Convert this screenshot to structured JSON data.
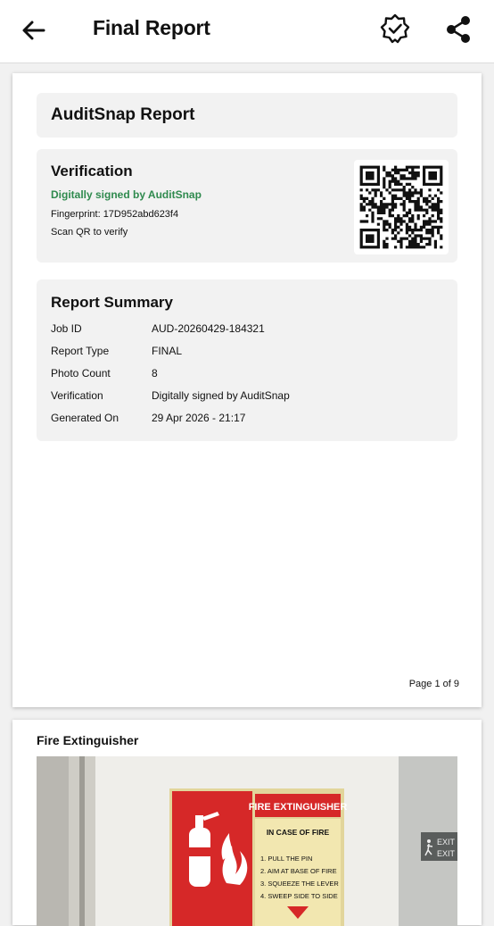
{
  "app_bar": {
    "title": "Final Report",
    "back_icon": "arrow-left-icon",
    "verify_icon": "verified-badge-icon",
    "share_icon": "share-icon"
  },
  "report": {
    "brand_title": "AuditSnap Report",
    "verification": {
      "heading": "Verification",
      "status": "Digitally signed by AuditSnap",
      "fingerprint": "Fingerprint: 17D952abd623f4",
      "instruction": "Scan QR to verify",
      "status_color": "#2f8a4e"
    },
    "summary": {
      "heading": "Report Summary",
      "rows": [
        {
          "label": "Job ID",
          "value": "AUD-20260429-184321"
        },
        {
          "label": "Report Type",
          "value": "FINAL"
        },
        {
          "label": "Photo Count",
          "value": "8"
        },
        {
          "label": "Verification",
          "value": "Digitally signed by AuditSnap"
        },
        {
          "label": "Generated On",
          "value": "29 Apr 2026 - 21:17"
        }
      ]
    },
    "page_indicator": "Page 1 of 9"
  },
  "page2": {
    "caption": "Fire Extinguisher",
    "sign": {
      "header": "FIRE EXTINGUISHER",
      "subheader": "IN CASE OF FIRE",
      "steps": [
        "1. PULL THE PIN",
        "2. AIM AT BASE OF FIRE",
        "3. SQUEEZE THE LEVER",
        "4. SWEEP SIDE TO SIDE"
      ],
      "exit_text": "EXIT",
      "sign_red": "#d62828",
      "sign_yellow": "#f2e7b0"
    }
  }
}
